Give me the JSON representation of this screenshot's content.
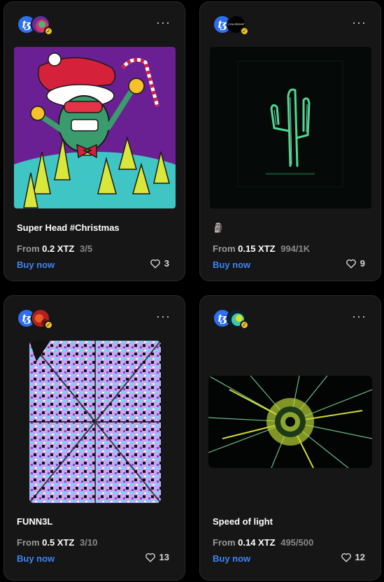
{
  "colors": {
    "card_bg": "#161616",
    "accent_link": "#3b86f2",
    "tezos_blue": "#2d6ff0",
    "verified_gold": "#f2c224"
  },
  "cards": [
    {
      "title": "Super Head #Christmas",
      "from": "From",
      "price": "0.2 XTZ",
      "edition": "3/5",
      "buy": "Buy now",
      "likes": "3",
      "tez": "ꜩ",
      "more": "···",
      "icon": "heart-icon"
    },
    {
      "title": "🗿",
      "creator_tag": "COLORSHIFT",
      "from": "From",
      "price": "0.15 XTZ",
      "edition": "994/1K",
      "buy": "Buy now",
      "likes": "9",
      "tez": "ꜩ",
      "more": "···",
      "icon": "heart-icon"
    },
    {
      "title": "FUNN3L",
      "from": "From",
      "price": "0.5 XTZ",
      "edition": "3/10",
      "buy": "Buy now",
      "likes": "13",
      "tez": "ꜩ",
      "more": "···",
      "icon": "heart-icon"
    },
    {
      "title": "Speed of light",
      "from": "From",
      "price": "0.14 XTZ",
      "edition": "495/500",
      "buy": "Buy now",
      "likes": "12",
      "tez": "ꜩ",
      "more": "···",
      "icon": "heart-icon"
    }
  ]
}
